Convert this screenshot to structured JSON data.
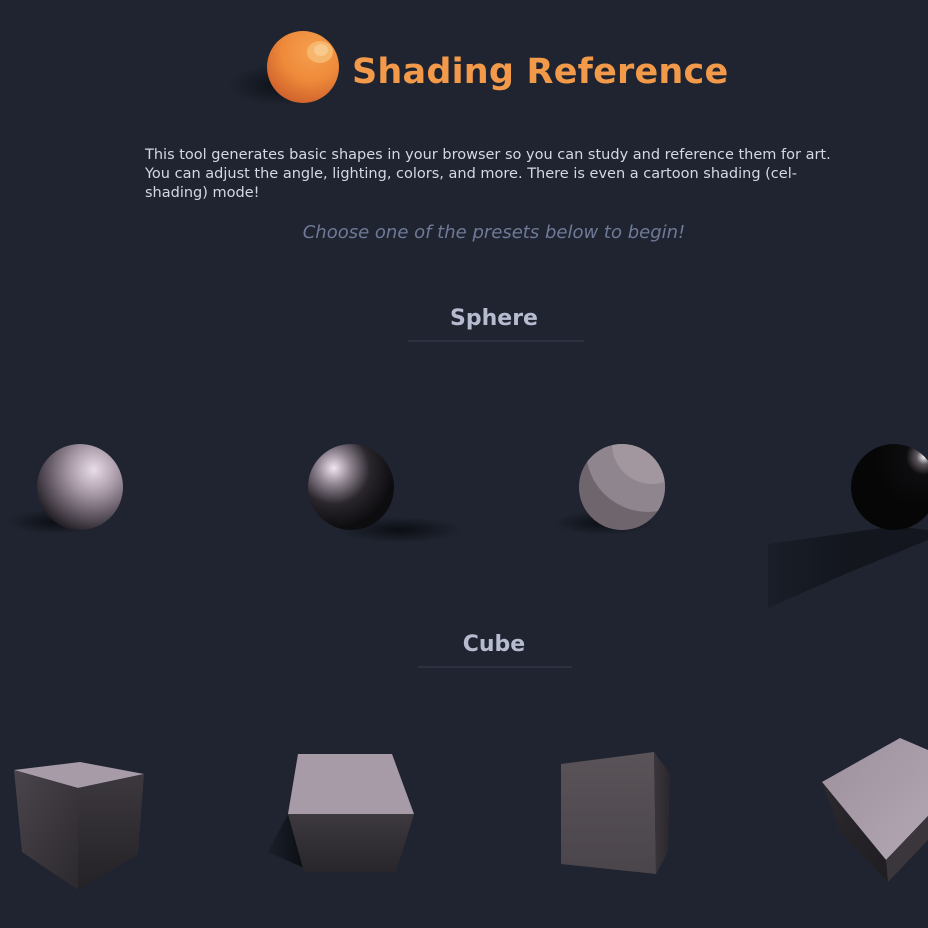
{
  "header": {
    "title": "Shading Reference",
    "logo_icon": "orange-sphere-logo-icon"
  },
  "intro": {
    "text": "This tool generates basic shapes in your browser so you can study and reference them for art. You can adjust the angle, lighting, colors, and more. There is even a cartoon shading (cel-shading) mode!",
    "cta": "Choose one of the presets below to begin!"
  },
  "sections": [
    {
      "title": "Sphere",
      "presets": [
        {
          "icon": "sphere-soft-light-preset-icon"
        },
        {
          "icon": "sphere-hard-light-preset-icon"
        },
        {
          "icon": "sphere-cel-shaded-preset-icon"
        },
        {
          "icon": "sphere-rim-light-preset-icon"
        }
      ]
    },
    {
      "title": "Cube",
      "presets": [
        {
          "icon": "cube-top-light-preset-icon"
        },
        {
          "icon": "cube-low-angle-preset-icon"
        },
        {
          "icon": "cube-front-view-preset-icon"
        },
        {
          "icon": "cube-tilted-preset-icon"
        }
      ]
    }
  ],
  "colors": {
    "background": "#1f2430",
    "accent": "#f39a4a",
    "body_text": "#d5d8e4",
    "muted_text": "#6f7a97",
    "heading": "#b6bbd0",
    "shape_light": "#a89ba8",
    "shape_dark": "#2f2c33"
  }
}
